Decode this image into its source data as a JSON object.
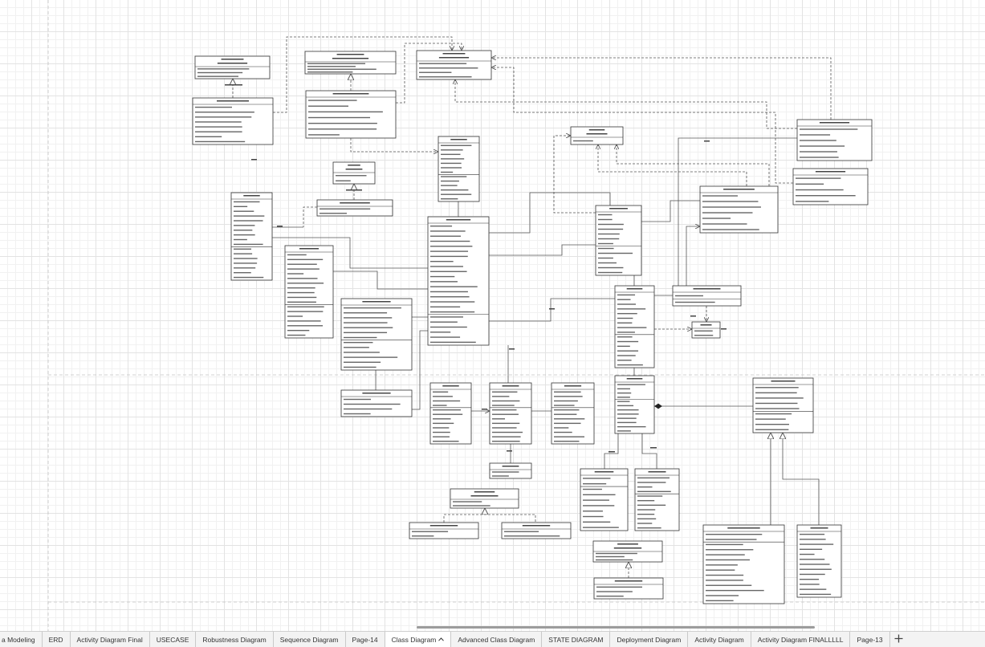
{
  "page_tabs": [
    {
      "label": "a Modeling",
      "active": false
    },
    {
      "label": "ERD",
      "active": false
    },
    {
      "label": "Activity Diagram Final",
      "active": false
    },
    {
      "label": "USECASE",
      "active": false
    },
    {
      "label": "Robustness Diagram",
      "active": false
    },
    {
      "label": "Sequence Diagram",
      "active": false
    },
    {
      "label": "Page-14",
      "active": false
    },
    {
      "label": "Class Diagram",
      "active": true
    },
    {
      "label": "Advanced Class Diagram",
      "active": false
    },
    {
      "label": "STATE DIAGRAM",
      "active": false
    },
    {
      "label": "Deployment Diagram",
      "active": false
    },
    {
      "label": "Activity Diagram",
      "active": false
    },
    {
      "label": "Activity Diagram FINALLLLL",
      "active": false
    },
    {
      "label": "Page-13",
      "active": false
    }
  ],
  "icons": {
    "active_tab_menu": "chevron-up-icon",
    "add_page": "plus-icon"
  },
  "colors": {
    "canvas_bg": "#ffffff",
    "grid": "#e3e3e3",
    "shape_stroke": "#333333",
    "connector": "#555555",
    "tab_bar_bg": "#f3f3f3",
    "active_tab_bg": "#ffffff",
    "tab_text": "#333333"
  }
}
